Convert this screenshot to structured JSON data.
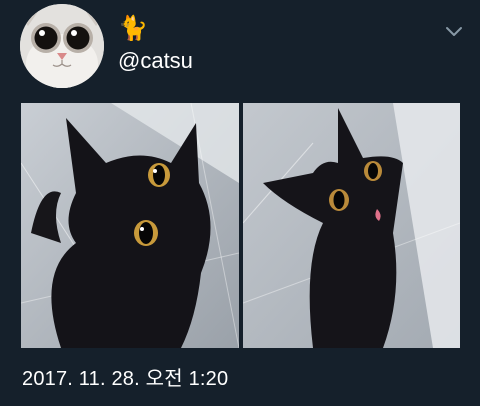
{
  "tweet": {
    "display_name": "🐈",
    "handle": "@catsu",
    "timestamp": "2017. 11. 28. 오전 1:20",
    "menu_icon": "chevron-down-icon",
    "media": [
      {
        "icon": "cat-photo-1"
      },
      {
        "icon": "cat-photo-2"
      }
    ]
  },
  "colors": {
    "background": "#15202b",
    "text": "#ffffff",
    "chevron": "#8899a6"
  }
}
